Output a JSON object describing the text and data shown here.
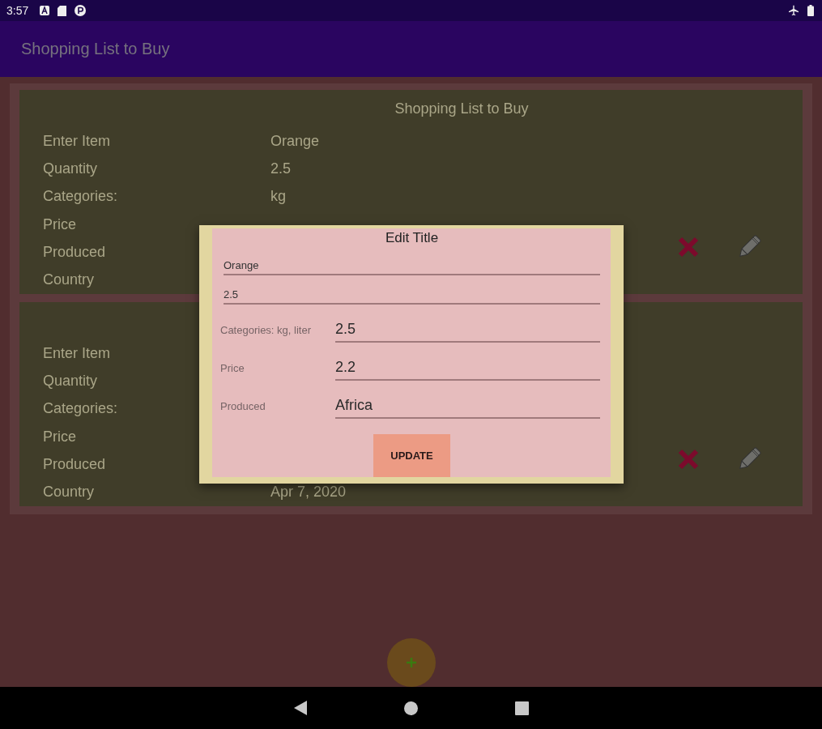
{
  "status_bar": {
    "time": "3:57"
  },
  "app_bar": {
    "title": "Shopping List to Buy"
  },
  "cards": [
    {
      "title": "Shopping List to Buy",
      "rows": [
        {
          "label": "Enter Item",
          "value": "Orange"
        },
        {
          "label": "Quantity",
          "value": "2.5"
        },
        {
          "label": "Categories:",
          "value": "kg"
        },
        {
          "label": "Price"
        },
        {
          "label": "Produced"
        },
        {
          "label": "Country"
        }
      ]
    },
    {
      "rows": [
        {
          "label": "Enter Item"
        },
        {
          "label": "Quantity"
        },
        {
          "label": "Categories:"
        },
        {
          "label": "Price"
        },
        {
          "label": "Produced"
        },
        {
          "label": "Country",
          "value": "Apr 7, 2020"
        }
      ]
    }
  ],
  "dialog": {
    "title": "Edit Title",
    "fields": [
      {
        "kind": "plain",
        "value": "Orange"
      },
      {
        "kind": "plain",
        "value": "2.5"
      },
      {
        "kind": "labeled",
        "label": "Categories: kg, liter",
        "value": "2.5"
      },
      {
        "kind": "labeled",
        "label": "Price",
        "value": "2.2"
      },
      {
        "kind": "labeled",
        "label": "Produced",
        "value": "Africa"
      }
    ],
    "button": "UPDATE"
  }
}
